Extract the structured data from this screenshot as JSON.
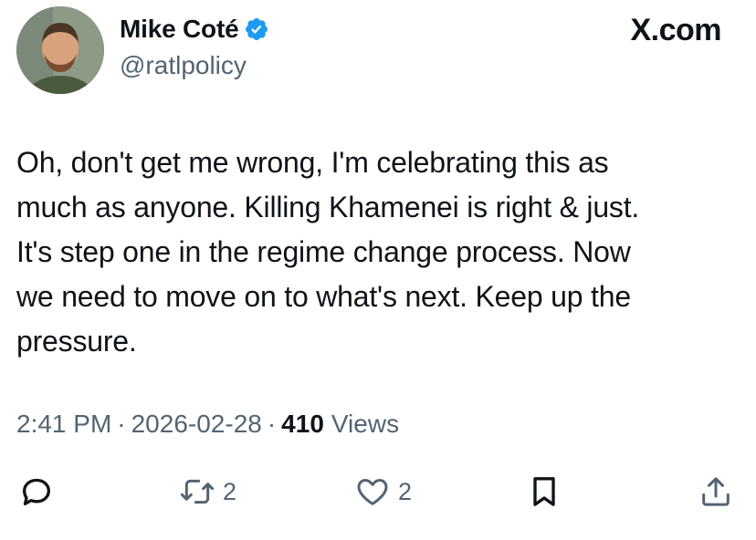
{
  "author": {
    "display_name": "Mike Coté",
    "handle": "@ratlpolicy",
    "verified": true,
    "verified_color": "#1d9bf0"
  },
  "brand": {
    "label": "X.com"
  },
  "tweet": {
    "text": "Oh, don't get me wrong, I'm celebrating this as\nmuch as anyone. Killing Khamenei is right & just.\nIt's step one in the regime change process. Now\nwe need to move on to what's next. Keep up the\npressure."
  },
  "meta": {
    "time": "2:41 PM",
    "separator": "·",
    "date": "2026-02-28",
    "views_count": "410",
    "views_label": "Views"
  },
  "actions": {
    "reply": {
      "icon": "reply-icon"
    },
    "retweet": {
      "icon": "retweet-icon",
      "count": "2"
    },
    "like": {
      "icon": "heart-icon",
      "count": "2"
    },
    "bookmark": {
      "icon": "bookmark-icon"
    },
    "share": {
      "icon": "share-icon"
    }
  },
  "colors": {
    "text": "#0f1419",
    "secondary": "#536471",
    "accent": "#1d9bf0"
  }
}
